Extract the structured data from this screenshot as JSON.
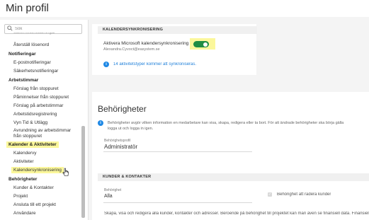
{
  "header": {
    "title": "Min profil"
  },
  "search": {
    "placeholder": "Sök"
  },
  "sidebar": {
    "clipped_item": "Säkerhetsinställningar",
    "items": [
      {
        "label": "Återställ lösenord",
        "type": "item"
      },
      {
        "label": "Notifieringar",
        "type": "header"
      },
      {
        "label": "E-postnotifieringar",
        "type": "item"
      },
      {
        "label": "Säkerhetsnotifieringar",
        "type": "item"
      },
      {
        "label": "Arbetstimmar",
        "type": "header"
      },
      {
        "label": "Förslag från stoppuret",
        "type": "item"
      },
      {
        "label": "Påminnelser från stoppuret",
        "type": "item"
      },
      {
        "label": "Förslag på arbetstimmar",
        "type": "item"
      },
      {
        "label": "Arbetstidsregistrering",
        "type": "item"
      },
      {
        "label": "Vyn Tid & Utlägg",
        "type": "item"
      },
      {
        "label": "Avrundning av arbetstimmar från stoppuret",
        "type": "item"
      },
      {
        "label": "Kalender & Aktiviteter",
        "type": "header"
      },
      {
        "label": "Kalendervy",
        "type": "item"
      },
      {
        "label": "Aktiviteter",
        "type": "item"
      },
      {
        "label": "Kalendersynkronisering",
        "type": "item"
      },
      {
        "label": "Behörigheter",
        "type": "header"
      },
      {
        "label": "Kunder & Kontakter",
        "type": "item"
      },
      {
        "label": "Projekt",
        "type": "item"
      },
      {
        "label": "Ansluta till ett projekt",
        "type": "item"
      },
      {
        "label": "Användare",
        "type": "item"
      }
    ]
  },
  "calendar_sync": {
    "section_title": "KALENDERSYNKRONISERING",
    "toggle_label": "Aktivera Microsoft kalendersynkronisering",
    "account_email": "Alexandra.Cyvoct@easystem.se",
    "toggle_on": true,
    "info_link": "14 aktivitetstyper kommer att synkroniseras."
  },
  "permissions": {
    "title": "Behörigheter",
    "info_text_line1": "Behörigheter avgör vilken information en medarbetare kan visa, skapa, redigera eller ta bort. För att ändrade behörigheter ska börja gälla",
    "info_text_line2": "logga ut och logga in igen.",
    "profile_label": "Behörighetsprofil",
    "profile_value": "Administratör",
    "customers_section_title": "KUNDER & KONTAKTER",
    "customers_perm_label": "Behörighet",
    "customers_perm_value": "Alla",
    "delete_checkbox_label": "Behörighet att radera kunder",
    "footer_text": "Skapa, visa och redigera alla kunder, kontakter och adresser. Beroende på behörighet till projektet kan man även se finansiell data. Finansiell"
  },
  "colors": {
    "toggle_on": "#1f8d44",
    "highlight": "#fbf79b",
    "info_blue": "#1e88e5",
    "link_blue": "#1e7fd9"
  }
}
